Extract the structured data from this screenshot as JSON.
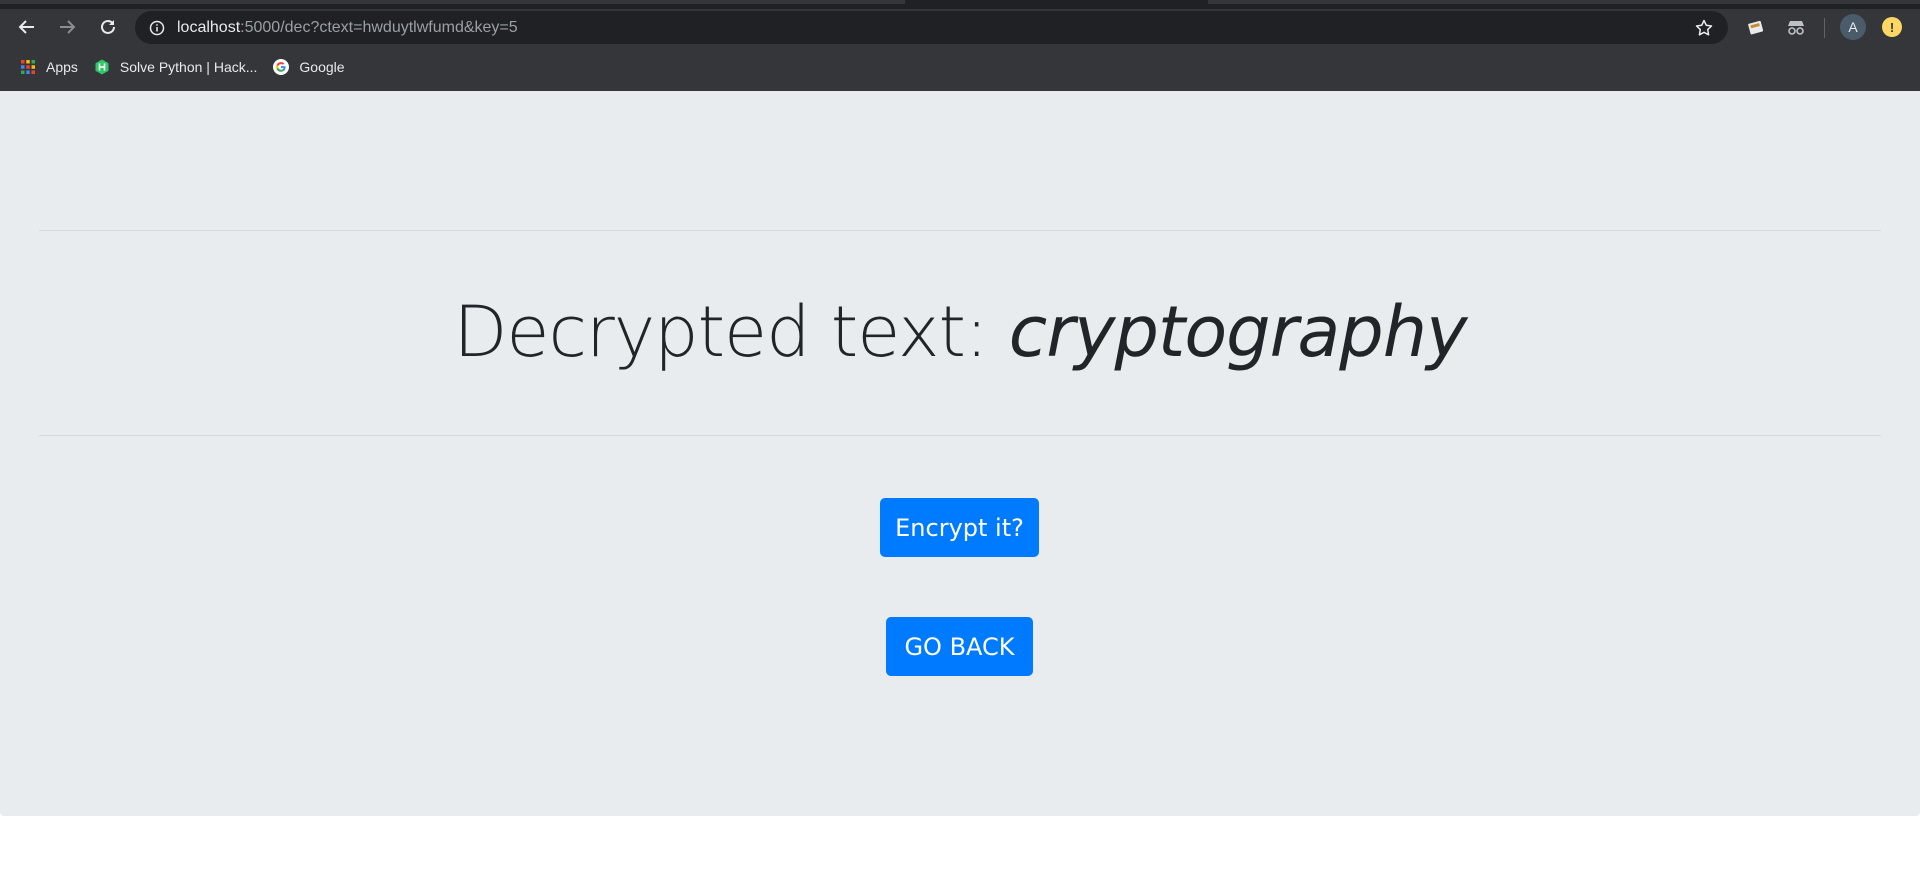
{
  "browser": {
    "url_host": "localhost",
    "url_rest": ":5000/dec?ctext=hwduytlwfumd&key=5",
    "avatar_letter": "A",
    "alert_symbol": "!",
    "bookmarks": [
      {
        "label": "Apps",
        "icon": "apps-grid-icon"
      },
      {
        "label": "Solve Python | Hack...",
        "icon": "hackerrank-icon"
      },
      {
        "label": "Google",
        "icon": "google-icon"
      }
    ]
  },
  "page": {
    "heading_prefix": "Decrypted text: ",
    "decrypted_text": "cryptography",
    "encrypt_button": "Encrypt it?",
    "back_button": "GO BACK"
  },
  "colors": {
    "chrome_bg": "#35363a",
    "omnibox_bg": "#202124",
    "page_bg": "#e9ecef",
    "button_primary": "#007bff",
    "heading_text": "#212529"
  }
}
